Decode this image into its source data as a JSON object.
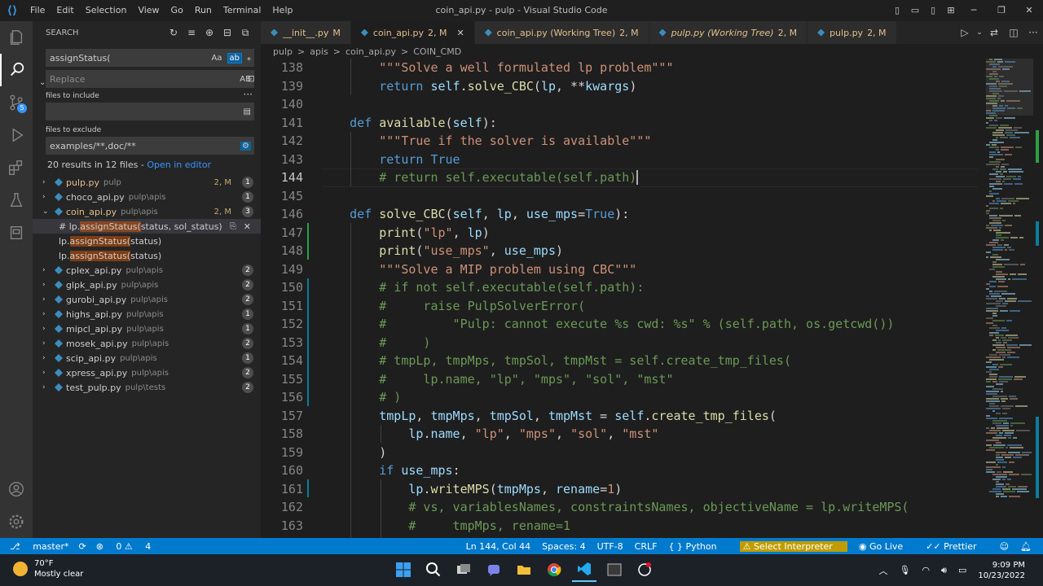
{
  "window": {
    "title": "coin_api.py - pulp - Visual Studio Code",
    "menu": [
      "File",
      "Edit",
      "Selection",
      "View",
      "Go",
      "Run",
      "Terminal",
      "Help"
    ]
  },
  "sidebar": {
    "title": "SEARCH",
    "search_value": "assignStatus(",
    "search_opts": [
      "Aa",
      "ab",
      "⁎"
    ],
    "replace_placeholder": "Replace",
    "replace_opt": "AB",
    "include_label": "files to include",
    "include_value": "",
    "exclude_label": "files to exclude",
    "exclude_value": "examples/**,doc/**",
    "summary": "20 results in 12 files - ",
    "open_in_editor": "Open in editor",
    "results": [
      {
        "name": "pulp.py",
        "path": "pulp",
        "count": "1",
        "mod": "2, M",
        "open": false
      },
      {
        "name": "choco_api.py",
        "path": "pulp\\apis",
        "count": "1",
        "mod": "",
        "open": false
      },
      {
        "name": "coin_api.py",
        "path": "pulp\\apis",
        "count": "3",
        "mod": "2, M",
        "open": true,
        "matches": [
          {
            "pre": "# lp.",
            "hit": "assignStatus(",
            "post": "status, sol_status)",
            "selected": true
          },
          {
            "pre": "lp.",
            "hit": "assignStatus(",
            "post": "status)",
            "selected": false
          },
          {
            "pre": "lp.",
            "hit": "assignStatus(",
            "post": "status)",
            "selected": false
          }
        ]
      },
      {
        "name": "cplex_api.py",
        "path": "pulp\\apis",
        "count": "2",
        "mod": "",
        "open": false
      },
      {
        "name": "glpk_api.py",
        "path": "pulp\\apis",
        "count": "2",
        "mod": "",
        "open": false
      },
      {
        "name": "gurobi_api.py",
        "path": "pulp\\apis",
        "count": "2",
        "mod": "",
        "open": false
      },
      {
        "name": "highs_api.py",
        "path": "pulp\\apis",
        "count": "1",
        "mod": "",
        "open": false
      },
      {
        "name": "mipcl_api.py",
        "path": "pulp\\apis",
        "count": "1",
        "mod": "",
        "open": false
      },
      {
        "name": "mosek_api.py",
        "path": "pulp\\apis",
        "count": "2",
        "mod": "",
        "open": false
      },
      {
        "name": "scip_api.py",
        "path": "pulp\\apis",
        "count": "1",
        "mod": "",
        "open": false
      },
      {
        "name": "xpress_api.py",
        "path": "pulp\\apis",
        "count": "2",
        "mod": "",
        "open": false
      },
      {
        "name": "test_pulp.py",
        "path": "pulp\\tests",
        "count": "2",
        "mod": "",
        "open": false
      }
    ]
  },
  "tabs": [
    {
      "label": "__init__.py",
      "status": "M",
      "italic": false,
      "active": false
    },
    {
      "label": "coin_api.py",
      "status": "2, M",
      "italic": false,
      "active": true
    },
    {
      "label": "coin_api.py (Working Tree)",
      "status": "2, M",
      "italic": false,
      "active": false
    },
    {
      "label": "pulp.py (Working Tree)",
      "status": "2, M",
      "italic": true,
      "active": false
    },
    {
      "label": "pulp.py",
      "status": "2, M",
      "italic": false,
      "active": false
    }
  ],
  "breadcrumb": [
    "pulp",
    ">",
    "apis",
    ">",
    "coin_api.py",
    ">",
    "COIN_CMD"
  ],
  "code": {
    "current_line": "144",
    "lines": [
      {
        "n": "138",
        "t": [
          [
            "",
            "        "
          ],
          [
            "str",
            "\"\"\"Solve a well formulated lp problem\"\"\""
          ]
        ]
      },
      {
        "n": "139",
        "t": [
          [
            "",
            "        "
          ],
          [
            "kw",
            "return "
          ],
          [
            "var",
            "self"
          ],
          [
            "op",
            "."
          ],
          [
            "fn",
            "solve_CBC"
          ],
          [
            "op",
            "("
          ],
          [
            "var",
            "lp"
          ],
          [
            "op",
            ", **"
          ],
          [
            "var",
            "kwargs"
          ],
          [
            "op",
            ")"
          ]
        ]
      },
      {
        "n": "140",
        "t": []
      },
      {
        "n": "141",
        "t": [
          [
            "",
            "    "
          ],
          [
            "kw",
            "def "
          ],
          [
            "fn",
            "available"
          ],
          [
            "op",
            "("
          ],
          [
            "var",
            "self"
          ],
          [
            "op",
            "):"
          ]
        ]
      },
      {
        "n": "142",
        "t": [
          [
            "",
            "        "
          ],
          [
            "str",
            "\"\"\"True if the solver is available\"\"\""
          ]
        ]
      },
      {
        "n": "143",
        "t": [
          [
            "",
            "        "
          ],
          [
            "kw",
            "return True"
          ]
        ]
      },
      {
        "n": "144",
        "t": [
          [
            "",
            "        "
          ],
          [
            "com",
            "# return self.executable(self.path)"
          ]
        ]
      },
      {
        "n": "145",
        "t": []
      },
      {
        "n": "146",
        "t": [
          [
            "",
            "    "
          ],
          [
            "kw",
            "def "
          ],
          [
            "fn",
            "solve_CBC"
          ],
          [
            "op",
            "("
          ],
          [
            "var",
            "self"
          ],
          [
            "op",
            ", "
          ],
          [
            "var",
            "lp"
          ],
          [
            "op",
            ", "
          ],
          [
            "var",
            "use_mps"
          ],
          [
            "op",
            "="
          ],
          [
            "kw",
            "True"
          ],
          [
            "op",
            "):"
          ]
        ]
      },
      {
        "n": "147",
        "t": [
          [
            "",
            "        "
          ],
          [
            "fn",
            "print"
          ],
          [
            "op",
            "("
          ],
          [
            "str",
            "\"lp\""
          ],
          [
            "op",
            ", "
          ],
          [
            "var",
            "lp"
          ],
          [
            "op",
            ")"
          ]
        ]
      },
      {
        "n": "148",
        "t": [
          [
            "",
            "        "
          ],
          [
            "fn",
            "print"
          ],
          [
            "op",
            "("
          ],
          [
            "str",
            "\"use_mps\""
          ],
          [
            "op",
            ", "
          ],
          [
            "var",
            "use_mps"
          ],
          [
            "op",
            ")"
          ]
        ]
      },
      {
        "n": "149",
        "t": [
          [
            "",
            "        "
          ],
          [
            "str",
            "\"\"\"Solve a MIP problem using CBC\"\"\""
          ]
        ]
      },
      {
        "n": "150",
        "t": [
          [
            "",
            "        "
          ],
          [
            "com",
            "# if not self.executable(self.path):"
          ]
        ]
      },
      {
        "n": "151",
        "t": [
          [
            "",
            "        "
          ],
          [
            "com",
            "#     raise PulpSolverError("
          ]
        ]
      },
      {
        "n": "152",
        "t": [
          [
            "",
            "        "
          ],
          [
            "com",
            "#         \"Pulp: cannot execute %s cwd: %s\" % (self.path, os.getcwd())"
          ]
        ]
      },
      {
        "n": "153",
        "t": [
          [
            "",
            "        "
          ],
          [
            "com",
            "#     )"
          ]
        ]
      },
      {
        "n": "154",
        "t": [
          [
            "",
            "        "
          ],
          [
            "com",
            "# tmpLp, tmpMps, tmpSol, tmpMst = self.create_tmp_files("
          ]
        ]
      },
      {
        "n": "155",
        "t": [
          [
            "",
            "        "
          ],
          [
            "com",
            "#     lp.name, \"lp\", \"mps\", \"sol\", \"mst\""
          ]
        ]
      },
      {
        "n": "156",
        "t": [
          [
            "",
            "        "
          ],
          [
            "com",
            "# )"
          ]
        ]
      },
      {
        "n": "157",
        "t": [
          [
            "",
            "        "
          ],
          [
            "var",
            "tmpLp"
          ],
          [
            "op",
            ", "
          ],
          [
            "var",
            "tmpMps"
          ],
          [
            "op",
            ", "
          ],
          [
            "var",
            "tmpSol"
          ],
          [
            "op",
            ", "
          ],
          [
            "var",
            "tmpMst"
          ],
          [
            "op",
            " = "
          ],
          [
            "var",
            "self"
          ],
          [
            "op",
            "."
          ],
          [
            "fn",
            "create_tmp_files"
          ],
          [
            "op",
            "("
          ]
        ]
      },
      {
        "n": "158",
        "t": [
          [
            "",
            "            "
          ],
          [
            "var",
            "lp"
          ],
          [
            "op",
            "."
          ],
          [
            "var",
            "name"
          ],
          [
            "op",
            ", "
          ],
          [
            "str",
            "\"lp\""
          ],
          [
            "op",
            ", "
          ],
          [
            "str",
            "\"mps\""
          ],
          [
            "op",
            ", "
          ],
          [
            "str",
            "\"sol\""
          ],
          [
            "op",
            ", "
          ],
          [
            "str",
            "\"mst\""
          ]
        ]
      },
      {
        "n": "159",
        "t": [
          [
            "",
            "        "
          ],
          [
            "op",
            ")"
          ]
        ]
      },
      {
        "n": "160",
        "t": [
          [
            "",
            "        "
          ],
          [
            "kw",
            "if "
          ],
          [
            "var",
            "use_mps"
          ],
          [
            "op",
            ":"
          ]
        ]
      },
      {
        "n": "161",
        "t": [
          [
            "",
            "            "
          ],
          [
            "var",
            "lp"
          ],
          [
            "op",
            "."
          ],
          [
            "fn",
            "writeMPS"
          ],
          [
            "op",
            "("
          ],
          [
            "var",
            "tmpMps"
          ],
          [
            "op",
            ", "
          ],
          [
            "var",
            "rename"
          ],
          [
            "op",
            "="
          ],
          [
            "str",
            "1"
          ],
          [
            "op",
            ")"
          ]
        ]
      },
      {
        "n": "162",
        "t": [
          [
            "",
            "            "
          ],
          [
            "com",
            "# vs, variablesNames, constraintsNames, objectiveName = lp.writeMPS("
          ]
        ]
      },
      {
        "n": "163",
        "t": [
          [
            "",
            "            "
          ],
          [
            "com",
            "#     tmpMps, rename=1"
          ]
        ]
      }
    ]
  },
  "status": {
    "branch": "master*",
    "errors": "0",
    "warnings": "4",
    "position": "Ln 144, Col 44",
    "spaces": "Spaces: 4",
    "encoding": "UTF-8",
    "eol": "CRLF",
    "language": "Python",
    "interpreter": "Select Interpreter",
    "golive": "Go Live",
    "prettier": "Prettier"
  },
  "taskbar": {
    "temp": "70°F",
    "condition": "Mostly clear",
    "time": "9:09 PM",
    "date": "10/23/2022"
  },
  "colors": {
    "statusbar": "#007acc",
    "accent": "#3794ff",
    "keyword": "#569cd6",
    "string": "#ce9178",
    "comment": "#6a9955",
    "function": "#dcdcaa"
  }
}
